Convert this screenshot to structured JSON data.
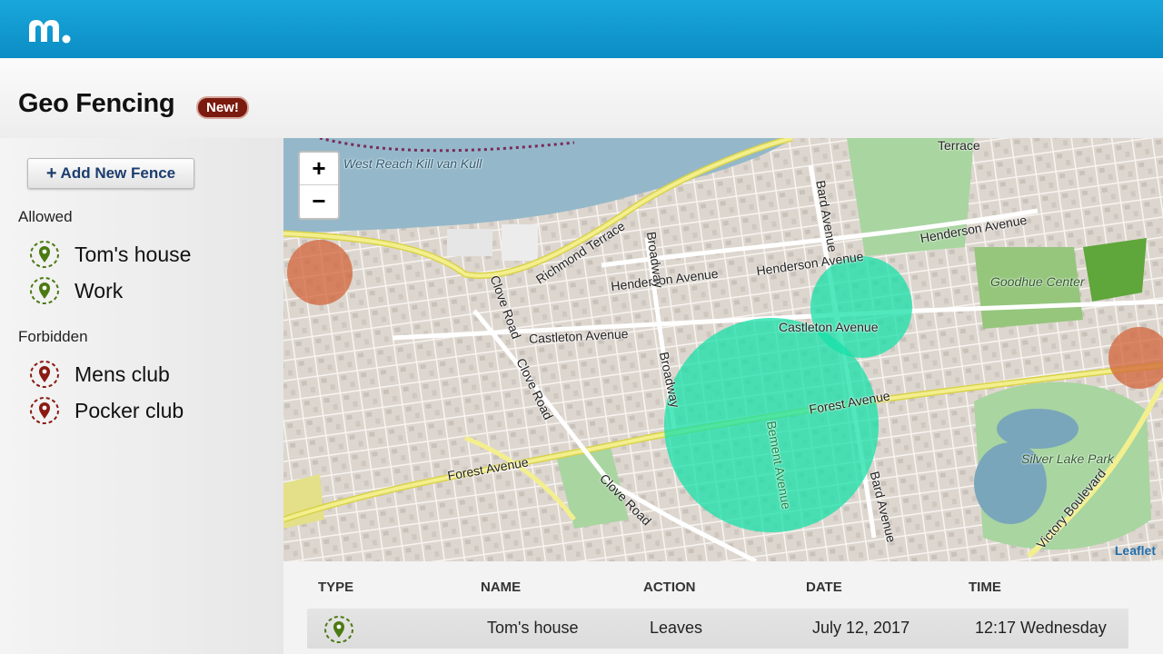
{
  "app": {
    "logo_icon": "mspy-logo-icon"
  },
  "page": {
    "title": "Geo Fencing",
    "badge": "New!"
  },
  "sidebar": {
    "add_button": {
      "icon": "plus-icon",
      "label": "Add New Fence"
    },
    "groups": [
      {
        "label": "Allowed",
        "items": [
          {
            "label": "Tom's house",
            "icon": "location-pin-icon",
            "color": "#4c7a12"
          },
          {
            "label": "Work",
            "icon": "location-pin-icon",
            "color": "#4c7a12"
          }
        ]
      },
      {
        "label": "Forbidden",
        "items": [
          {
            "label": "Mens club",
            "icon": "location-pin-icon",
            "color": "#8a1b12"
          },
          {
            "label": "Pocker club",
            "icon": "location-pin-icon",
            "color": "#8a1b12"
          }
        ]
      }
    ]
  },
  "map": {
    "zoom_in": "+",
    "zoom_out": "−",
    "attribution": "Leaflet",
    "street_labels": [
      "West Reach Kill van Kull",
      "Richmond Terrace",
      "Henderson Avenue",
      "Castleton Avenue",
      "Forest Avenue",
      "Clove Road",
      "Broadway",
      "Bard Avenue",
      "Bement Avenue",
      "Goodhue Center",
      "Silver Lake Park",
      "Victory Boulevard",
      "Terrace"
    ],
    "fence_colors": {
      "allowed": "#17e0a8",
      "forbidden": "#d2643a"
    }
  },
  "table": {
    "headers": [
      "TYPE",
      "NAME",
      "ACTION",
      "DATE",
      "TIME"
    ],
    "rows": [
      {
        "type_icon": "location-pin-icon",
        "name": "Tom's house",
        "action": "Leaves",
        "date": "July 12, 2017",
        "time": "12:17 Wednesday"
      }
    ]
  }
}
